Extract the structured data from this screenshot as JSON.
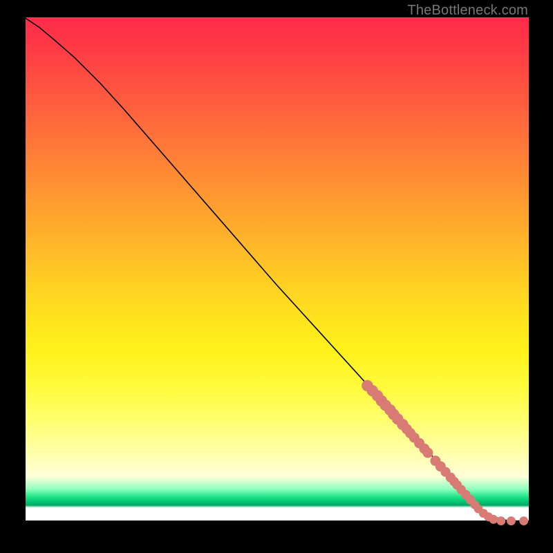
{
  "watermark": "TheBottleneck.com",
  "colors": {
    "dot": "#d77b74",
    "line": "#000000"
  },
  "chart_data": {
    "type": "line",
    "title": "",
    "xlabel": "",
    "ylabel": "",
    "xlim": [
      0,
      100
    ],
    "ylim": [
      0,
      100
    ],
    "grid": false,
    "legend": false,
    "series": [
      {
        "name": "curve",
        "x": [
          0,
          3,
          6,
          10,
          15,
          20,
          30,
          40,
          50,
          60,
          70,
          75,
          80,
          84,
          87,
          90,
          93,
          96,
          100
        ],
        "y": [
          100,
          98,
          95.5,
          92,
          87,
          81.5,
          70,
          58.5,
          47,
          36,
          25,
          19.5,
          14,
          9.5,
          6,
          3,
          1,
          0.2,
          0.2
        ]
      }
    ],
    "scatter": [
      {
        "name": "dots",
        "points": [
          {
            "x": 68,
            "y": 27,
            "r": 1.1
          },
          {
            "x": 69,
            "y": 26,
            "r": 1.1
          },
          {
            "x": 70,
            "y": 25,
            "r": 1.1
          },
          {
            "x": 70.8,
            "y": 24,
            "r": 1.1
          },
          {
            "x": 71.6,
            "y": 23.1,
            "r": 1.1
          },
          {
            "x": 72.5,
            "y": 22.2,
            "r": 1.1
          },
          {
            "x": 73.2,
            "y": 21.3,
            "r": 1.1
          },
          {
            "x": 74.0,
            "y": 20.4,
            "r": 1.1
          },
          {
            "x": 75.0,
            "y": 19.3,
            "r": 1.1
          },
          {
            "x": 75.8,
            "y": 18.4,
            "r": 1.0
          },
          {
            "x": 76.5,
            "y": 17.6,
            "r": 1.0
          },
          {
            "x": 77.3,
            "y": 16.7,
            "r": 1.0
          },
          {
            "x": 78.3,
            "y": 15.6,
            "r": 1.0
          },
          {
            "x": 79.3,
            "y": 14.5,
            "r": 1.0
          },
          {
            "x": 80.0,
            "y": 13.7,
            "r": 1.0
          },
          {
            "x": 81.5,
            "y": 12.1,
            "r": 1.0
          },
          {
            "x": 82.5,
            "y": 11.0,
            "r": 1.0
          },
          {
            "x": 83.5,
            "y": 9.9,
            "r": 0.95
          },
          {
            "x": 84.5,
            "y": 8.8,
            "r": 0.95
          },
          {
            "x": 85.2,
            "y": 8.0,
            "r": 0.9
          },
          {
            "x": 85.8,
            "y": 7.3,
            "r": 0.9
          },
          {
            "x": 86.6,
            "y": 6.4,
            "r": 0.9
          },
          {
            "x": 87.5,
            "y": 5.4,
            "r": 0.9
          },
          {
            "x": 88.4,
            "y": 4.4,
            "r": 0.9
          },
          {
            "x": 89.3,
            "y": 3.4,
            "r": 0.85
          },
          {
            "x": 90.0,
            "y": 2.6,
            "r": 0.85
          },
          {
            "x": 91.0,
            "y": 1.7,
            "r": 0.85
          },
          {
            "x": 92.0,
            "y": 1.0,
            "r": 0.85
          },
          {
            "x": 93.0,
            "y": 0.5,
            "r": 0.85
          },
          {
            "x": 94.5,
            "y": 0.2,
            "r": 0.85
          },
          {
            "x": 96.5,
            "y": 0.2,
            "r": 0.85
          },
          {
            "x": 99.0,
            "y": 0.2,
            "r": 0.85
          }
        ]
      }
    ]
  }
}
